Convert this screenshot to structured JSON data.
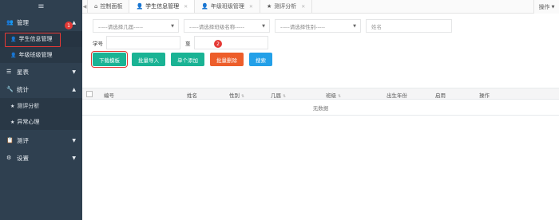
{
  "sidebar": {
    "toggle_icon": "≡",
    "management": {
      "label": "管理",
      "icon": "users-icon"
    },
    "management_items": [
      {
        "label": "学生信息管理"
      },
      {
        "label": "年级班级管理"
      }
    ],
    "star_table": {
      "label": "星表"
    },
    "statistics": {
      "label": "统计"
    },
    "statistics_items": [
      {
        "label": "测评分析"
      },
      {
        "label": "异常心理"
      }
    ],
    "evaluation": {
      "label": "测评"
    },
    "settings": {
      "label": "设置"
    },
    "annotation_1": "1"
  },
  "tabs": [
    {
      "label": "控制面板"
    },
    {
      "label": "学生信息管理"
    },
    {
      "label": "年级班级管理"
    },
    {
      "label": "测评分析"
    }
  ],
  "tabs_right": {
    "label": "操作"
  },
  "filters": {
    "grade_select": "-----请选择几届-----",
    "class_select": "-----请选择班级名称-----",
    "gender_select": "-----请选择性别-----",
    "name_placeholder": "姓名"
  },
  "id_row": {
    "label": "学号",
    "to": "至"
  },
  "annotation_2": "2",
  "actions": {
    "download_template": "下载模板",
    "bulk_import": "批量导入",
    "single_add": "单个添加",
    "bulk_delete": "批量删除",
    "search": "搜索"
  },
  "table": {
    "columns": [
      "编号",
      "姓名",
      "性别",
      "几届",
      "班级",
      "出生年份",
      "启用",
      "操作"
    ],
    "empty_text": "无数据"
  },
  "colors": {
    "sidebar": "#2f4050",
    "teal": "#1ab394",
    "orange": "#ed5e2b",
    "blue": "#23a0e8",
    "highlight": "#e53935"
  }
}
